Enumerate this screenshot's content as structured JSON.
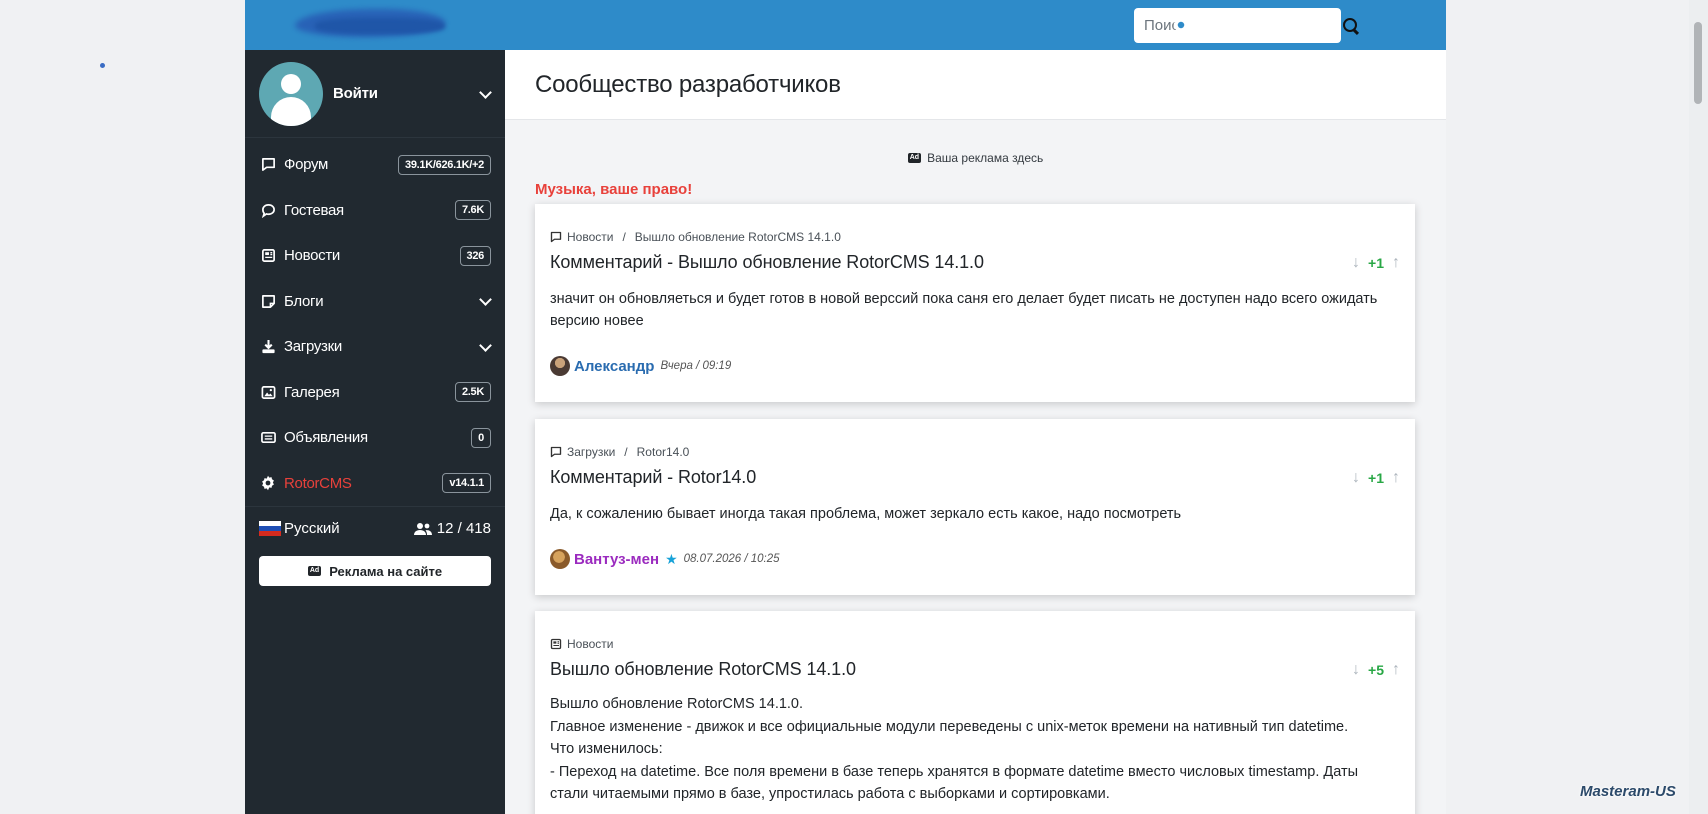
{
  "search": {
    "placeholder": "Поиск"
  },
  "sidebar": {
    "login_label": "Войти",
    "items": [
      {
        "label": "Форум",
        "badge": "39.1K/626.1K/+2",
        "icon": "chat-icon"
      },
      {
        "label": "Гостевая",
        "badge": "7.6K",
        "icon": "comment-icon"
      },
      {
        "label": "Новости",
        "badge": "326",
        "icon": "newspaper-icon"
      },
      {
        "label": "Блоги",
        "badge": "",
        "icon": "note-icon"
      },
      {
        "label": "Загрузки",
        "badge": "",
        "icon": "download-icon"
      },
      {
        "label": "Галерея",
        "badge": "2.5K",
        "icon": "image-icon"
      },
      {
        "label": "Объявления",
        "badge": "0",
        "icon": "rectangle-list-icon"
      },
      {
        "label": "RotorCMS",
        "badge": "v14.1.1",
        "icon": "gear-icon"
      }
    ],
    "language": "Русский",
    "online": "12 / 418",
    "ad_button": "Реклама на сайте",
    "ad_icon_text": "Ad"
  },
  "page": {
    "title": "Сообщество разработчиков",
    "ad_here": "Ваша реклама здесь",
    "promo": "Музыка, ваше право!"
  },
  "cards": [
    {
      "crumbs": [
        "Новости",
        "Вышло обновление RotorCMS 14.1.0"
      ],
      "title": "Комментарий - Вышло обновление RotorCMS 14.1.0",
      "rating": "+1",
      "text": "значит он обновляеться и будет готов в новой версcий пока саня его делает будет писать не доступен надо всего ожидать версию новее",
      "author": "Александр",
      "author_color": "#2a6cb0",
      "date": "Вчера / 09:19"
    },
    {
      "crumbs": [
        "Загрузки",
        "Rotor14.0"
      ],
      "title": "Комментарий - Rotor14.0",
      "rating": "+1",
      "text": "Да, к сожалению бывает иногда такая проблема, может зеркало есть какое, надо посмотреть",
      "author": "Вантуз-мен",
      "author_color": "#9b2bbf",
      "date": "08.07.2026 / 10:25"
    },
    {
      "crumbs": [
        "Новости"
      ],
      "title": "Вышло обновление RotorCMS 14.1.0",
      "rating": "+5",
      "lines": [
        "Вышло обновление RotorCMS 14.1.0.",
        "Главное изменение - движок и все официальные модули переведены с unix-меток времени на нативный тип datetime.",
        "Что изменилось:",
        "- Переход на datetime. Все поля времени в базе теперь хранятся в формате datetime вместо числовых timestamp. Даты стали читаемыми прямо в базе, упростилась работа с выборками и сортировками."
      ]
    }
  ],
  "watermark": "Masteram-US",
  "colors": {
    "topbar": "#2e8bc9",
    "sidebar": "#212930",
    "accent": "#e8413b",
    "rating": "#28a745"
  }
}
